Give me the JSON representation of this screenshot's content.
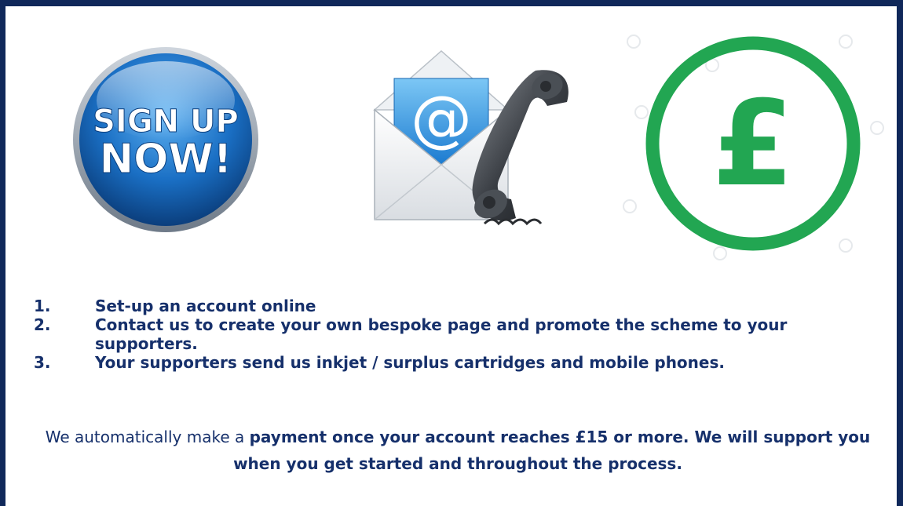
{
  "badge": {
    "line1": "SIGN UP",
    "line2": "NOW!",
    "colors": {
      "outer": "#0a5fb3",
      "inner": "#2a8be0",
      "text": "#ffffff"
    }
  },
  "contact": {
    "at_symbol": "@",
    "icons": [
      "envelope-icon",
      "telephone-handset-icon"
    ]
  },
  "pound": {
    "symbol": "£",
    "color": "#22a652"
  },
  "steps": [
    {
      "number": "1.",
      "text": "Set-up an account online"
    },
    {
      "number": "2.",
      "text": "Contact us to create your own bespoke page and promote the scheme to your supporters."
    },
    {
      "number": "3.",
      "text": "Your supporters send us inkjet / surplus cartridges and mobile phones."
    }
  ],
  "note": {
    "regular": "We automatically make a ",
    "bold": "payment once your account reaches £15 or more. We will support you when you get started and throughout the process."
  },
  "theme": {
    "frame": "#10285a",
    "text": "#16306b"
  }
}
